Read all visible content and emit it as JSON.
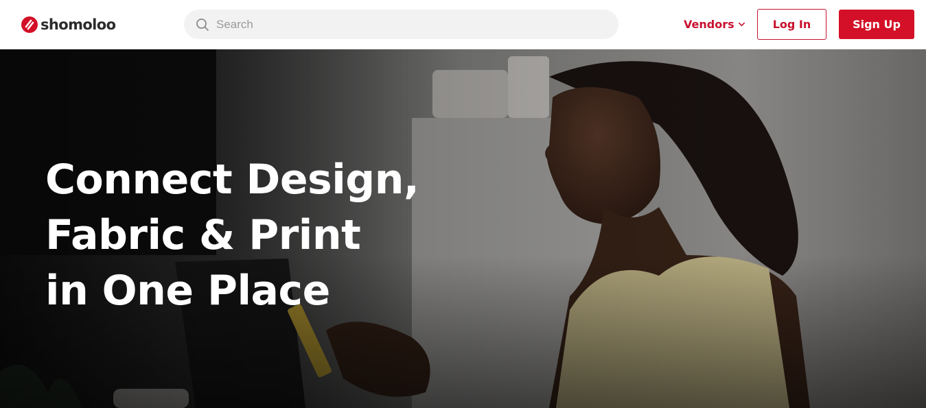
{
  "header": {
    "logo_text": "shomoloo",
    "search_placeholder": "Search",
    "vendors_label": "Vendors",
    "login_label": "Log In",
    "signup_label": "Sign Up"
  },
  "hero": {
    "title_lines": [
      "Connect Design,",
      "Fabric & Print",
      "in One Place"
    ]
  },
  "colors": {
    "brand_red": "#d31027",
    "nav_text": "#c8102e",
    "logo_text": "#2b2b2b"
  },
  "icons": {
    "logo": "shomoloo-logo-icon",
    "search": "search-icon",
    "vendors_dropdown": "chevron-down-icon"
  }
}
